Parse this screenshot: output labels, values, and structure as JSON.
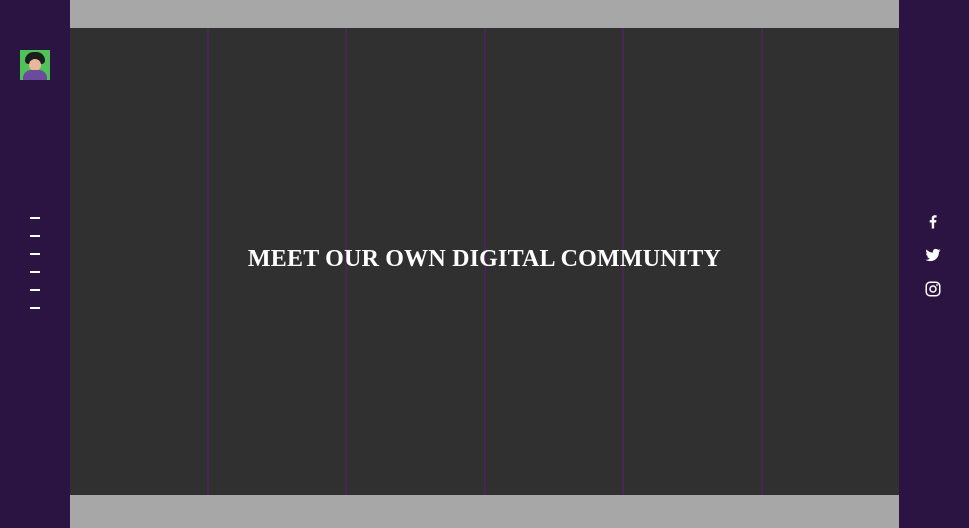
{
  "hero": {
    "headline": "MEET OUR OWN DIGITAL COMMUNITY"
  },
  "nav": {
    "menu_items_count": 6,
    "avatar_icon": "user-avatar"
  },
  "social": [
    {
      "name": "facebook",
      "icon": "facebook-icon"
    },
    {
      "name": "twitter",
      "icon": "twitter-icon"
    },
    {
      "name": "instagram",
      "icon": "instagram-icon"
    }
  ],
  "colors": {
    "rail": "#2c1442",
    "panel": "#303030",
    "frame": "#a7a7a7",
    "divider": "#4b2457",
    "text": "#ffffff"
  }
}
